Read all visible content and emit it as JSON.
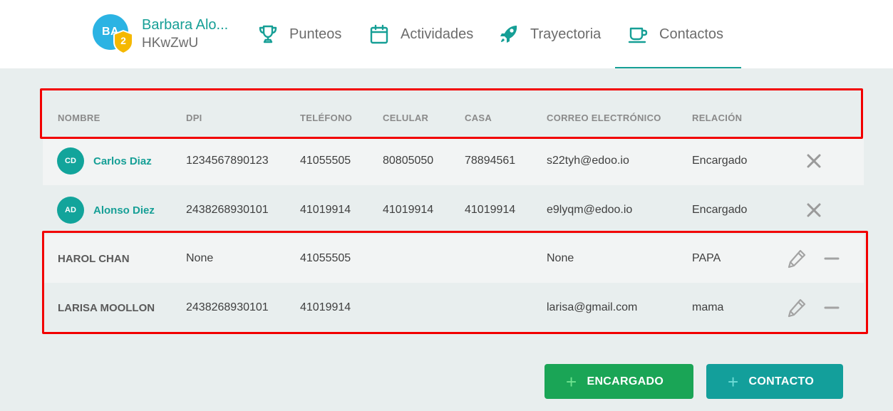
{
  "profile": {
    "initials": "BA",
    "level": "2",
    "name": "Barbara Alo...",
    "code": "HKwZwU"
  },
  "tabs": [
    {
      "label": "Punteos",
      "icon": "trophy-icon"
    },
    {
      "label": "Actividades",
      "icon": "calendar-icon"
    },
    {
      "label": "Trayectoria",
      "icon": "rocket-icon"
    },
    {
      "label": "Contactos",
      "icon": "coffee-cup-icon",
      "active": true
    }
  ],
  "table": {
    "headers": [
      "NOMBRE",
      "DPI",
      "TELÉFONO",
      "CELULAR",
      "CASA",
      "CORREO ELECTRÓNICO",
      "RELACIÓN"
    ],
    "guardians": [
      {
        "initials": "CD",
        "name": "Carlos Diaz",
        "dpi": "1234567890123",
        "telefono": "41055505",
        "celular": "80805050",
        "casa": "78894561",
        "correo": "s22tyh@edoo.io",
        "relacion": "Encargado"
      },
      {
        "initials": "AD",
        "name": "Alonso Diez",
        "dpi": "2438268930101",
        "telefono": "41019914",
        "celular": "41019914",
        "casa": "41019914",
        "correo": "e9lyqm@edoo.io",
        "relacion": "Encargado"
      }
    ],
    "contacts": [
      {
        "name": "HAROL CHAN",
        "dpi": "None",
        "telefono": "41055505",
        "celular": "",
        "casa": "",
        "correo": "None",
        "relacion": "PAPA"
      },
      {
        "name": "LARISA MOOLLON",
        "dpi": "2438268930101",
        "telefono": "41019914",
        "celular": "",
        "casa": "",
        "correo": "larisa@gmail.com",
        "relacion": "mama"
      }
    ]
  },
  "buttons": {
    "add_guardian": "ENCARGADO",
    "add_contact": "CONTACTO"
  },
  "colors": {
    "brand_teal": "#169f96",
    "green_button": "#1aa556",
    "teal_button": "#139f9b",
    "highlight_red": "#f20000",
    "avatar_blue": "#2bb3e3",
    "badge_gold": "#f5b800"
  }
}
